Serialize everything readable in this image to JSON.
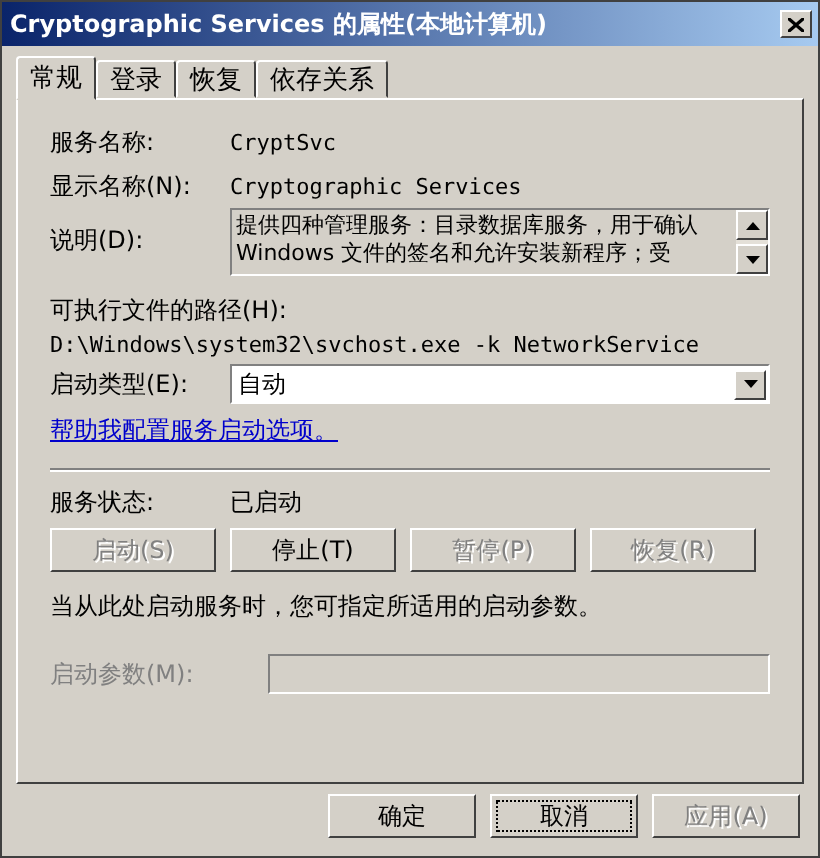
{
  "window": {
    "title": "Cryptographic Services 的属性(本地计算机)"
  },
  "tabs": [
    {
      "label": "常规",
      "selected": true
    },
    {
      "label": "登录",
      "selected": false
    },
    {
      "label": "恢复",
      "selected": false
    },
    {
      "label": "依存关系",
      "selected": false
    }
  ],
  "general": {
    "service_name": {
      "label": "服务名称:",
      "value": "CryptSvc"
    },
    "display_name": {
      "label": "显示名称(N):",
      "value": "Cryptographic Services"
    },
    "description": {
      "label": "说明(D):",
      "value": "提供四种管理服务：目录数据库服务，用于确认 Windows 文件的签名和允许安装新程序；受"
    },
    "path": {
      "label": "可执行文件的路径(H):",
      "value": "D:\\Windows\\system32\\svchost.exe -k NetworkService"
    },
    "startup_type": {
      "label": "启动类型(E):",
      "value": "自动"
    },
    "help_link": "帮助我配置服务启动选项。",
    "status": {
      "label": "服务状态:",
      "value": "已启动"
    },
    "service_buttons": [
      {
        "label": "启动(S)",
        "disabled": true
      },
      {
        "label": "停止(T)",
        "disabled": false
      },
      {
        "label": "暂停(P)",
        "disabled": true
      },
      {
        "label": "恢复(R)",
        "disabled": true
      }
    ],
    "note": "当从此处启动服务时，您可指定所适用的启动参数。",
    "start_params": {
      "label": "启动参数(M):",
      "disabled": true
    }
  },
  "buttons": [
    {
      "label": "确定",
      "disabled": false,
      "focused": false
    },
    {
      "label": "取消",
      "disabled": false,
      "focused": true
    },
    {
      "label": "应用(A)",
      "disabled": true,
      "focused": false
    }
  ]
}
